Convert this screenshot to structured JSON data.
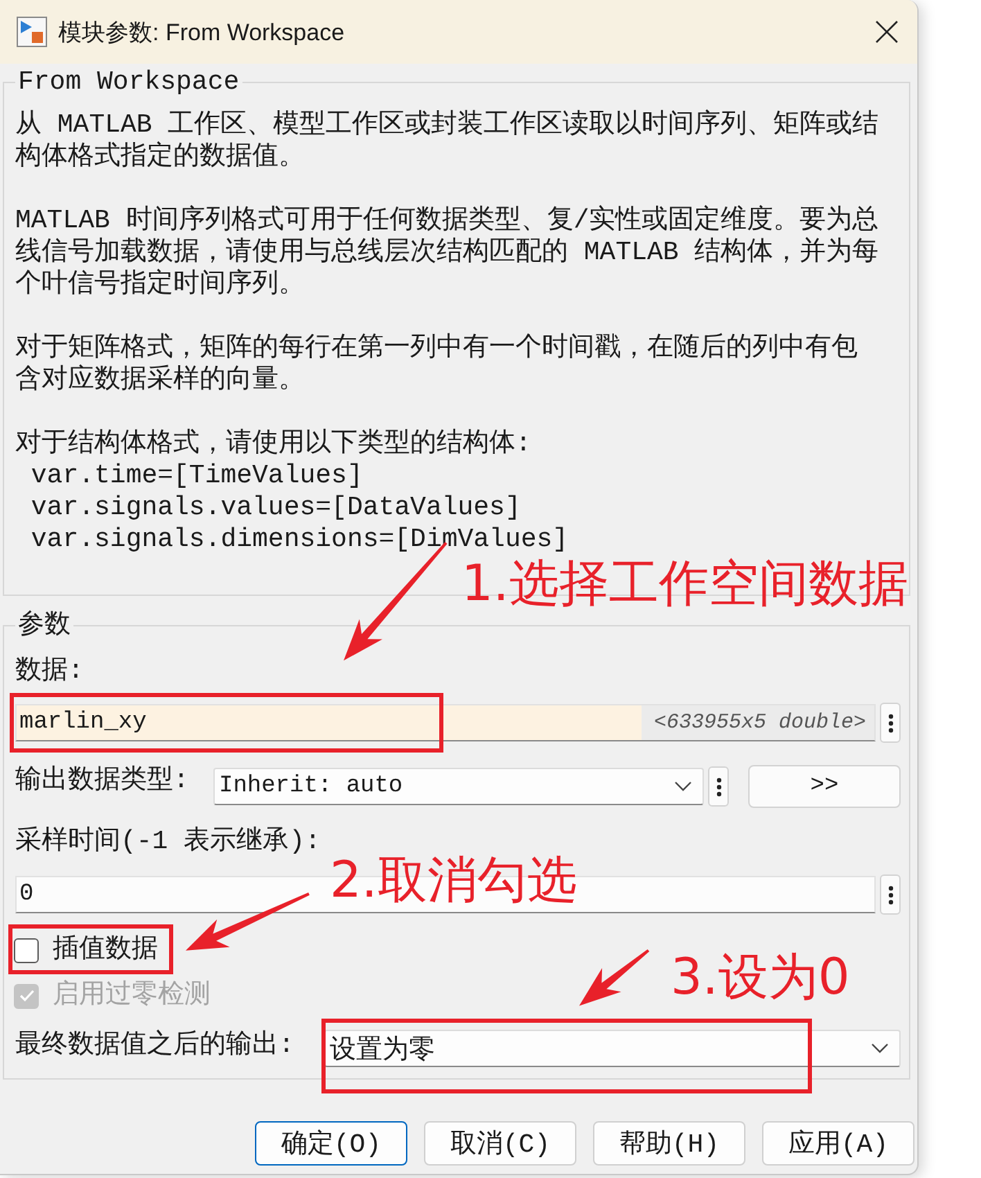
{
  "window": {
    "title": "模块参数: From Workspace"
  },
  "description": {
    "title": "From Workspace",
    "paragraphs": [
      "从 MATLAB 工作区、模型工作区或封装工作区读取以时间序列、矩阵或结构体格式指定的数据值。",
      "MATLAB 时间序列格式可用于任何数据类型、复/实性或固定维度。要为总线信号加载数据，请使用与总线层次结构匹配的 MATLAB 结构体，并为每个叶信号指定时间序列。",
      "对于矩阵格式，矩阵的每行在第一列中有一个时间戳，在随后的列中有包含对应数据采样的向量。",
      "对于结构体格式，请使用以下类型的结构体:\n var.time=[TimeValues]\n var.signals.values=[DataValues]\n var.signals.dimensions=[DimValues]"
    ]
  },
  "parameters": {
    "title": "参数",
    "data": {
      "label": "数据:",
      "value": "marlin_xy",
      "info": "<633955x5 double>"
    },
    "output_data_type": {
      "label": "输出数据类型:",
      "value": "Inherit: auto",
      "button": ">>"
    },
    "sample_time": {
      "label": "采样时间(-1 表示继承):",
      "value": "0"
    },
    "checkboxes": [
      {
        "label": "插值数据",
        "checked": false,
        "disabled": false
      },
      {
        "label": "启用过零检测",
        "checked": true,
        "disabled": true
      }
    ],
    "output_after_final": {
      "label": "最终数据值之后的输出:",
      "value": "设置为零"
    }
  },
  "buttons": [
    {
      "label": "确定(O)",
      "default": true
    },
    {
      "label": "取消(C)",
      "default": false
    },
    {
      "label": "帮助(H)",
      "default": false
    },
    {
      "label": "应用(A)",
      "default": false
    }
  ],
  "annotations": [
    {
      "text": "1.选择工作空间数据"
    },
    {
      "text": "2.取消勾选"
    },
    {
      "text": "3.设为0"
    }
  ]
}
